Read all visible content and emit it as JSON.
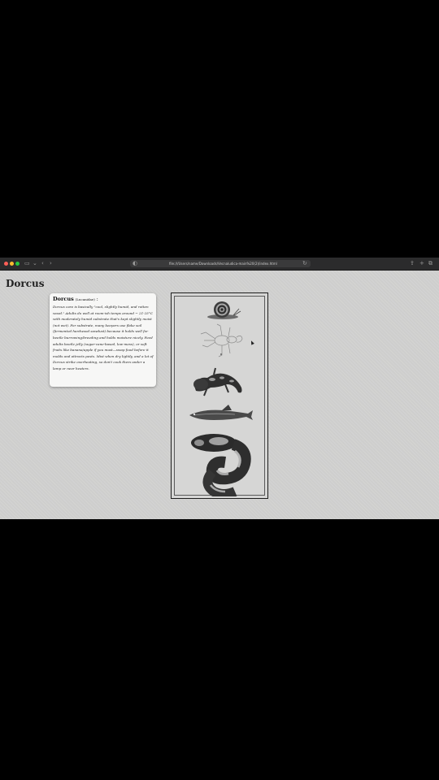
{
  "browser": {
    "url": "file:///Users/name/Downloads/Vecnaludica-main%20(2)/index.html",
    "traffic_colors": [
      "#ff5f57",
      "#febc2e",
      "#28c840"
    ],
    "icons": [
      "sidebar-icon",
      "chevron-down-icon",
      "back-icon",
      "forward-icon",
      "shield-icon",
      "reload-icon",
      "share-icon",
      "new-tab-icon",
      "tabs-overview-icon"
    ]
  },
  "page": {
    "title": "Dorcus"
  },
  "card": {
    "name": "Dorcus",
    "scientific": "(Lucanidae)",
    "separator": " :",
    "body": "Dorcus care is basically \"cool, slightly humid, and rotten wood.\" Adults do well at room-ish temps around ~ 21-25°C with moderately humid substrate that's kept slightly moist (not wet). For substrate, many keepers use flake soil (fermented hardwood sawdust) because it holds well for beetle burrowing/breeding and holds moisture nicely. Feed adults beetle jelly (sugar-cane-based, low-mess), or soft fruits like banana/apple if you must—swap food before it molds and attracts pests. Mist when dry lightly, and a lot of Dorcus strike overheating, so don't cook them under a lamp or near heaters."
  },
  "specimens": [
    {
      "name": "snail"
    },
    {
      "name": "beetle-sketch"
    },
    {
      "name": "salamander"
    },
    {
      "name": "fish"
    },
    {
      "name": "snake"
    }
  ]
}
